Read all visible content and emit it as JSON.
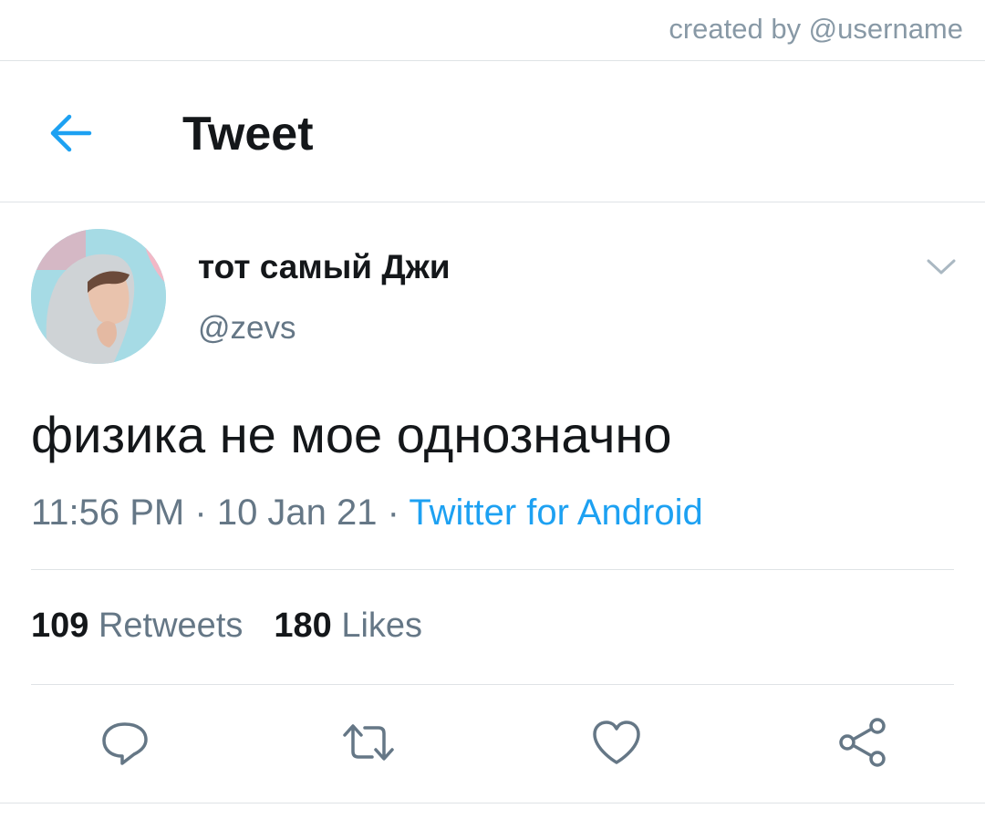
{
  "credit": "created by @username",
  "header": {
    "back_icon": "arrow-left-icon",
    "title": "Tweet"
  },
  "tweet": {
    "display_name": "тот самый Джи",
    "handle": "@zevs",
    "text": "физика не мое однозначно",
    "time": "11:56 PM",
    "date": "10 Jan 21",
    "separator": "·",
    "source": "Twitter for Android"
  },
  "stats": {
    "retweets_count": "109",
    "retweets_label": "Retweets",
    "likes_count": "180",
    "likes_label": "Likes"
  },
  "actions": [
    "reply-icon",
    "retweet-icon",
    "like-icon",
    "share-icon"
  ],
  "colors": {
    "accent": "#1da1f2",
    "secondary_text": "#657786",
    "divider": "#dfe3e6"
  }
}
